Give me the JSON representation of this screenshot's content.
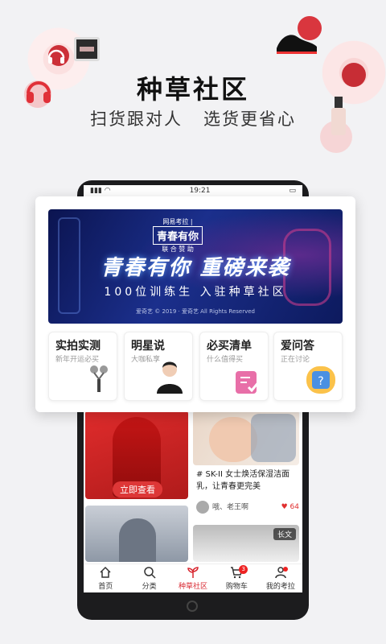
{
  "hero": {
    "title": "种草社区",
    "subtitle": "扫货跟对人   选货更省心"
  },
  "phone": {
    "status_time": "19:21"
  },
  "popup": {
    "banner": {
      "logo_left": "网易考拉",
      "logo_right": "青春有你",
      "logo_sub": "联 合 赞 助",
      "title": "青春有你 重磅来袭",
      "subtitle": "100位训练生  入驻种草社区",
      "copyright": "爱奇艺 © 2019 · 爱奇艺 All Rights Reserved"
    },
    "categories": [
      {
        "title": "实拍实测",
        "subtitle": "新年开运必买",
        "icon": "roller-icon"
      },
      {
        "title": "明星说",
        "subtitle": "大咖私享",
        "icon": "avatar-icon"
      },
      {
        "title": "必买清单",
        "subtitle": "什么值得买",
        "icon": "checklist-icon"
      },
      {
        "title": "爱问答",
        "subtitle": "正在讨论",
        "icon": "question-icon"
      }
    ]
  },
  "feed": {
    "red_card_button": "立即查看",
    "post_text": "# SK-II 女士焕活保湿洁面乳，让青春更完美",
    "post_author": "哦、老王啊",
    "post_likes": "64",
    "long_tag": "长文"
  },
  "tabbar": {
    "tabs": [
      {
        "label": "首页",
        "icon": "home-icon"
      },
      {
        "label": "分类",
        "icon": "search-icon"
      },
      {
        "label": "种草社区",
        "icon": "sprout-icon",
        "active": true
      },
      {
        "label": "购物车",
        "icon": "cart-icon",
        "badge": "3"
      },
      {
        "label": "我的考拉",
        "icon": "user-icon"
      }
    ]
  },
  "colors": {
    "accent": "#d8262f",
    "banner_blue": "#1b2f8c"
  }
}
